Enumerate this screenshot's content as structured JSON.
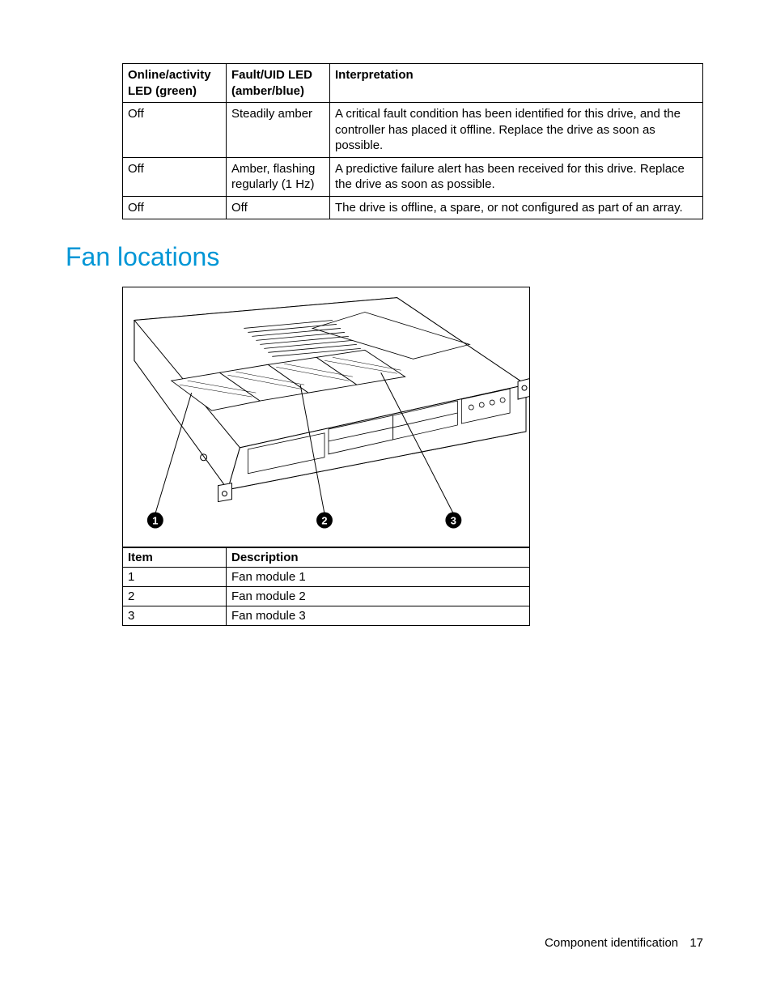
{
  "led_table": {
    "headers": [
      "Online/activity LED (green)",
      "Fault/UID LED (amber/blue)",
      "Interpretation"
    ],
    "rows": [
      {
        "c1": "Off",
        "c2": "Steadily amber",
        "c3": "A critical fault condition has been identified for this drive, and the controller has placed it offline. Replace the drive as soon as possible."
      },
      {
        "c1": "Off",
        "c2": "Amber, flashing regularly (1 Hz)",
        "c3": "A predictive failure alert has been received for this drive. Replace the drive as soon as possible."
      },
      {
        "c1": "Off",
        "c2": "Off",
        "c3": "The drive is offline, a spare, or not configured as part of an array."
      }
    ]
  },
  "section_heading": "Fan locations",
  "diagram": {
    "callouts": [
      "1",
      "2",
      "3"
    ]
  },
  "fan_table": {
    "headers": [
      "Item",
      "Description"
    ],
    "rows": [
      {
        "item": "1",
        "desc": "Fan module 1"
      },
      {
        "item": "2",
        "desc": "Fan module 2"
      },
      {
        "item": "3",
        "desc": "Fan module 3"
      }
    ]
  },
  "footer": {
    "section": "Component identification",
    "page": "17"
  }
}
